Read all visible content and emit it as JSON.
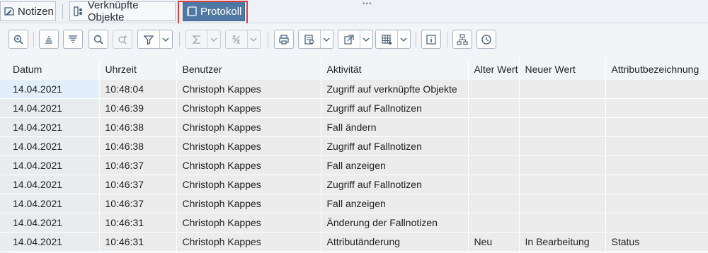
{
  "tabs": [
    {
      "label": "Notizen",
      "icon": "notes-icon"
    },
    {
      "label": "Verknüpfte Objekte",
      "icon": "linked-objects-icon"
    },
    {
      "label": "Protokoll",
      "icon": "log-icon",
      "active": true
    }
  ],
  "toolbar_icons": [
    "zoom-icon",
    "align-top-icon",
    "align-filter-icon",
    "search-icon",
    "search-next-icon",
    "filter-icon",
    "sum-icon",
    "subtotal-icon",
    "print-icon",
    "view-icon",
    "export-icon",
    "layout-icon",
    "info-icon",
    "hierarchy-icon",
    "history-icon"
  ],
  "columns": [
    "Datum",
    "Uhrzeit",
    "Benutzer",
    "Aktivität",
    "Alter Wert",
    "Neuer Wert",
    "Attributbezeichnung"
  ],
  "rows": [
    [
      "14.04.2021",
      "10:48:04",
      "Christoph Kappes",
      "Zugriff auf verknüpfte Objekte",
      "",
      "",
      ""
    ],
    [
      "14.04.2021",
      "10:46:39",
      "Christoph Kappes",
      "Zugriff auf Fallnotizen",
      "",
      "",
      ""
    ],
    [
      "14.04.2021",
      "10:46:38",
      "Christoph Kappes",
      "Fall ändern",
      "",
      "",
      ""
    ],
    [
      "14.04.2021",
      "10:46:38",
      "Christoph Kappes",
      "Zugriff auf Fallnotizen",
      "",
      "",
      ""
    ],
    [
      "14.04.2021",
      "10:46:37",
      "Christoph Kappes",
      "Fall anzeigen",
      "",
      "",
      ""
    ],
    [
      "14.04.2021",
      "10:46:37",
      "Christoph Kappes",
      "Zugriff auf Fallnotizen",
      "",
      "",
      ""
    ],
    [
      "14.04.2021",
      "10:46:37",
      "Christoph Kappes",
      "Fall anzeigen",
      "",
      "",
      ""
    ],
    [
      "14.04.2021",
      "10:46:31",
      "Christoph Kappes",
      "Änderung der Fallnotizen",
      "",
      "",
      ""
    ],
    [
      "14.04.2021",
      "10:46:31",
      "Christoph Kappes",
      "Attributänderung",
      "Neu",
      "In Bearbeitung",
      "Status"
    ]
  ],
  "colors": {
    "active_tab": "#4d79a4",
    "highlight": "#e03c3c",
    "cell_bg": "#ececec"
  }
}
